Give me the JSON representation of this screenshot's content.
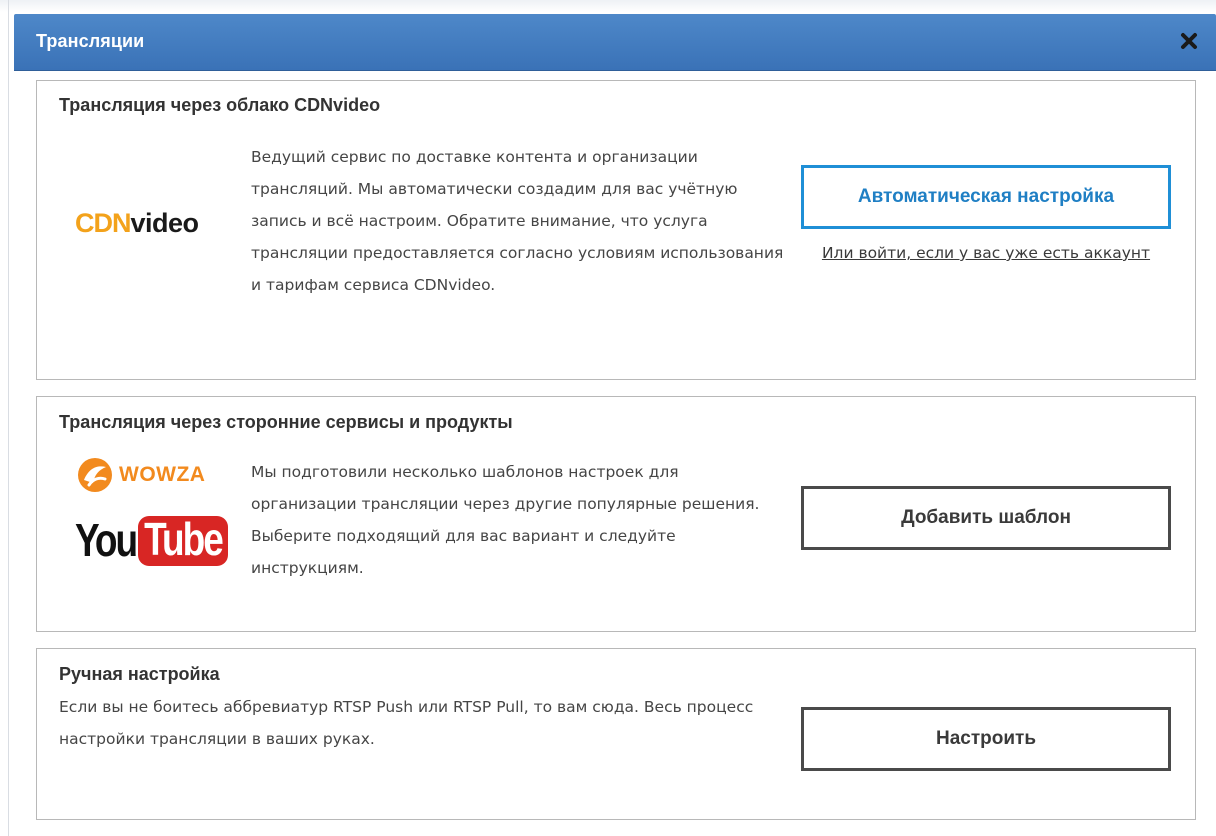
{
  "dialog": {
    "title": "Трансляции",
    "close_icon": "close-icon",
    "header_color": "#3f78bd"
  },
  "cards": {
    "cdn": {
      "title": "Трансляция через облако CDNvideo",
      "logo": {
        "mark": "CDN",
        "word": "video",
        "mark_color": "#f3a21b"
      },
      "description": "Ведущий сервис по доставке контента и организации трансляций. Мы автоматически создадим для вас учётную запись и всё настроим. Обратите внимание, что услуга трансляции предоставляется согласно условиям использования и тарифам сервиса CDNvideo.",
      "primary_button": "Автоматическая настройка",
      "login_link": "Или войти, если у вас уже есть аккаунт",
      "accent_color": "#1f8fd6"
    },
    "third_party": {
      "title": "Трансляция через сторонние сервисы и продукты",
      "logos": {
        "wowza": "WOWZA",
        "youtube_you": "You",
        "youtube_tube": "Tube"
      },
      "description": "Мы подготовили несколько шаблонов настроек для организации трансляции через другие популярные решения. Выберите подходящий для вас вариант и следуйте инструкциям.",
      "button": "Добавить шаблон"
    },
    "manual": {
      "title": "Ручная настройка",
      "description": "Если вы не боитесь аббревиатур RTSP Push или RTSP Pull, то вам сюда. Весь процесс настройки трансляции в ваших руках.",
      "button": "Настроить"
    }
  }
}
